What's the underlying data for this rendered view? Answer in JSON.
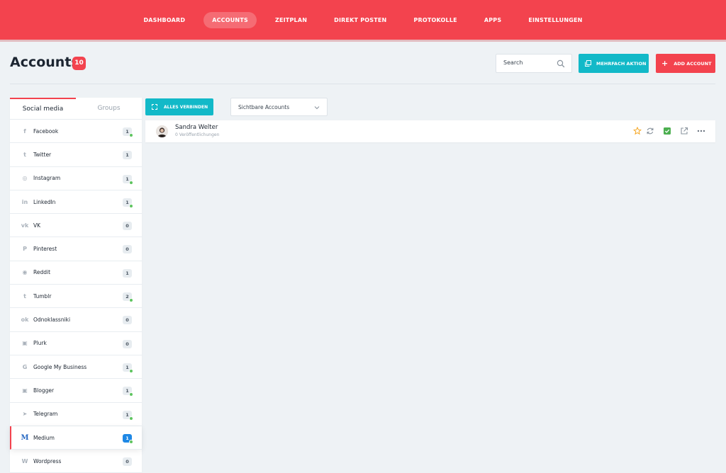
{
  "nav": {
    "items": [
      {
        "label": "DASHBOARD"
      },
      {
        "label": "ACCOUNTS",
        "active": true
      },
      {
        "label": "ZEITPLAN"
      },
      {
        "label": "DIREKT POSTEN"
      },
      {
        "label": "PROTOKOLLE"
      },
      {
        "label": "APPS"
      },
      {
        "label": "EINSTELLUNGEN"
      }
    ]
  },
  "header": {
    "title": "Accounts",
    "count": "10",
    "search_placeholder": "Search",
    "multi_action_label": "MEHRFACH AKTION",
    "add_account_label": "ADD ACCOUNT"
  },
  "sidebar": {
    "tabs": [
      {
        "label": "Social media",
        "active": true
      },
      {
        "label": "Groups"
      }
    ],
    "items": [
      {
        "label": "Facebook",
        "icon": "facebook-icon",
        "glyph": "f",
        "count": "1",
        "online": true
      },
      {
        "label": "Twitter",
        "icon": "twitter-icon",
        "glyph": "t",
        "count": "1",
        "online": false
      },
      {
        "label": "Instagram",
        "icon": "instagram-icon",
        "glyph": "◎",
        "count": "1",
        "online": true
      },
      {
        "label": "LinkedIn",
        "icon": "linkedin-icon",
        "glyph": "in",
        "count": "1",
        "online": true
      },
      {
        "label": "VK",
        "icon": "vk-icon",
        "glyph": "vk",
        "count": "0",
        "online": false
      },
      {
        "label": "Pinterest",
        "icon": "pinterest-icon",
        "glyph": "P",
        "count": "0",
        "online": false
      },
      {
        "label": "Reddit",
        "icon": "reddit-icon",
        "glyph": "◉",
        "count": "1",
        "online": false
      },
      {
        "label": "Tumblr",
        "icon": "tumblr-icon",
        "glyph": "t",
        "count": "2",
        "online": true
      },
      {
        "label": "Odnoklassniki",
        "icon": "odnoklassniki-icon",
        "glyph": "ok",
        "count": "0",
        "online": false
      },
      {
        "label": "Plurk",
        "icon": "plurk-icon",
        "glyph": "▣",
        "count": "0",
        "online": false
      },
      {
        "label": "Google My Business",
        "icon": "google-icon",
        "glyph": "G",
        "count": "1",
        "online": true
      },
      {
        "label": "Blogger",
        "icon": "blogger-icon",
        "glyph": "▣",
        "count": "1",
        "online": true
      },
      {
        "label": "Telegram",
        "icon": "telegram-icon",
        "glyph": "➤",
        "count": "1",
        "online": true
      },
      {
        "label": "Medium",
        "icon": "medium-icon",
        "glyph": "M",
        "count": "1",
        "online": true,
        "active": true
      },
      {
        "label": "Wordpress",
        "icon": "wordpress-icon",
        "glyph": "W",
        "count": "0",
        "online": false
      }
    ]
  },
  "toolbar": {
    "connect_all_label": "ALLES VERBINDEN",
    "visible_accounts_label": "Sichtbare Accounts"
  },
  "accounts": [
    {
      "name": "Sandra Welter",
      "subtitle": "0 Veröffentlichungen"
    }
  ],
  "colors": {
    "brand": "#f3434e",
    "accent": "#12b9c8",
    "online": "#5ec45f",
    "star": "#f5a623",
    "check": "#4caf50"
  }
}
